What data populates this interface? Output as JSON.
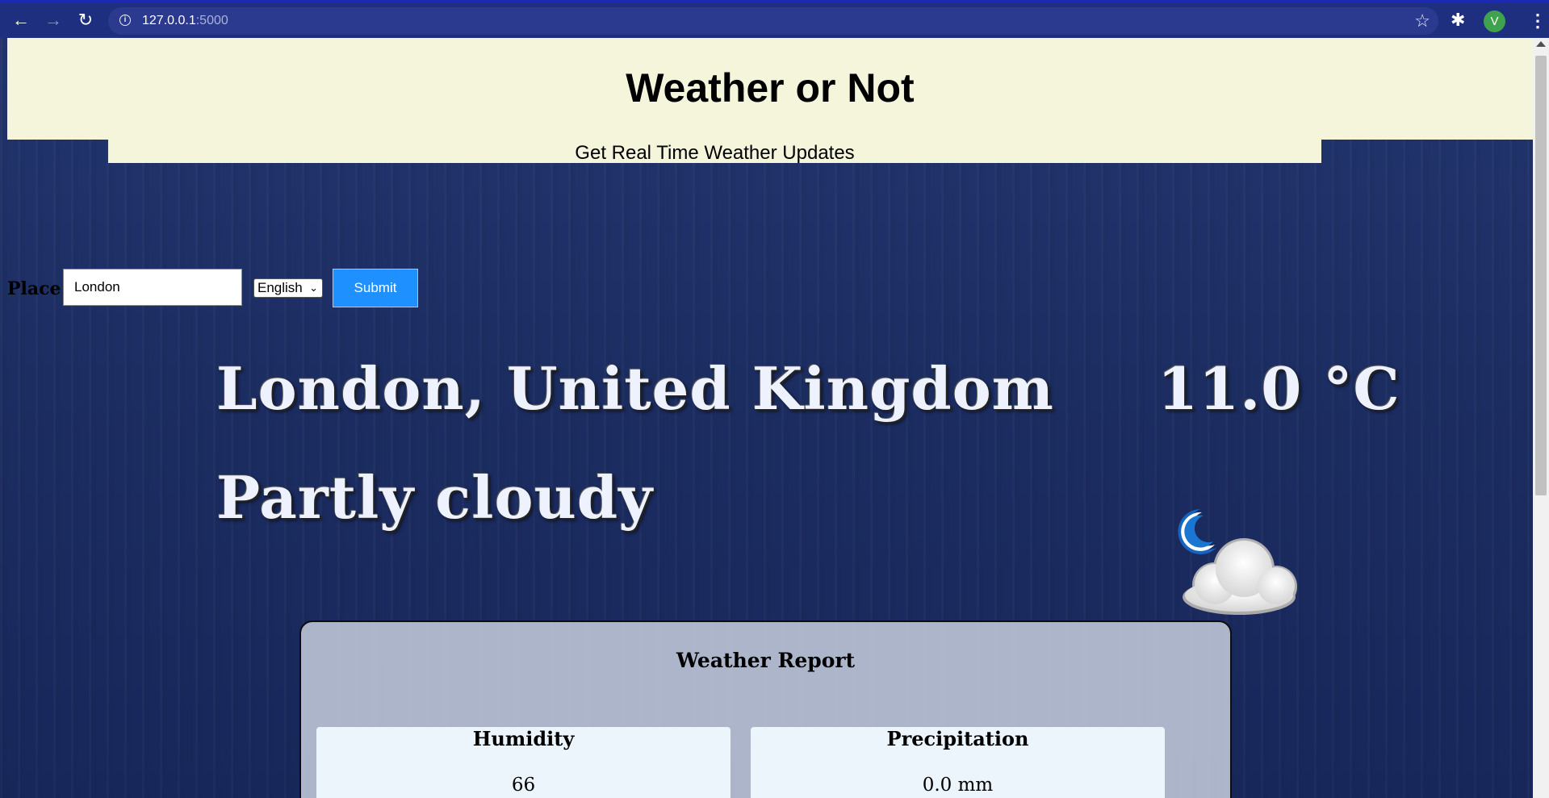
{
  "browser": {
    "url_host": "127.0.0.1",
    "url_port": ":5000",
    "profile_initial": "V",
    "back_icon": "←",
    "forward_icon": "→",
    "reload_icon": "↻",
    "info_icon": "i",
    "star_icon": "☆",
    "extensions_icon": "✱",
    "menu_icon": "⋮"
  },
  "header": {
    "title": "Weather or Not",
    "tagline": "Get Real Time Weather Updates"
  },
  "form": {
    "place_label": "Place",
    "place_value": "London",
    "language_selected": "English",
    "submit_label": "Submit"
  },
  "current": {
    "location": "London, United Kingdom",
    "temperature": "11.0 °C",
    "condition": "Partly cloudy",
    "icon": "moon-cloud-icon"
  },
  "report": {
    "title": "Weather Report",
    "humidity_label": "Humidity",
    "humidity_value": "66",
    "precipitation_label": "Precipitation",
    "precipitation_value": "0.0 mm"
  },
  "colors": {
    "chrome_bg": "#1f2f80",
    "header_bg": "#f5f5dc",
    "submit_bg": "#1e90ff",
    "page_bg": "#1c2d62"
  }
}
